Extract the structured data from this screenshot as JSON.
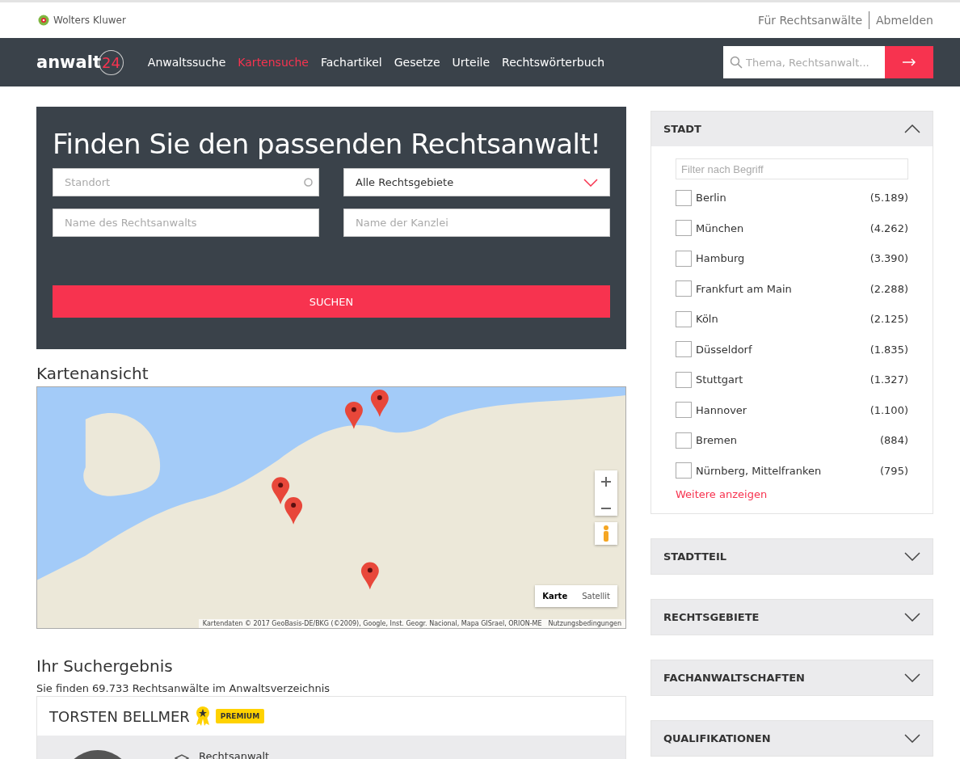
{
  "header": {
    "brand": "Wolters Kluwer",
    "links": [
      {
        "label": "Für Rechtsanwälte"
      },
      {
        "label": "Abmelden"
      }
    ]
  },
  "nav": {
    "logo": {
      "word": "anwalt",
      "number": "24"
    },
    "items": [
      {
        "label": "Anwaltssuche",
        "selected": false
      },
      {
        "label": "Kartensuche",
        "selected": true
      },
      {
        "label": "Fachartikel",
        "selected": false
      },
      {
        "label": "Gesetze",
        "selected": false
      },
      {
        "label": "Urteile",
        "selected": false
      },
      {
        "label": "Rechtswörterbuch",
        "selected": false
      }
    ],
    "search": {
      "placeholder": "Thema, Rechtsanwalt..."
    }
  },
  "search_panel": {
    "title": "Finden Sie den passenden Rechtsanwalt!",
    "fields": [
      {
        "kind": "location",
        "placeholder": "Standort"
      },
      {
        "kind": "select",
        "value": "Alle Rechtsgebiete"
      },
      {
        "kind": "text",
        "placeholder": "Name des Rechtsanwalts"
      },
      {
        "kind": "text",
        "placeholder": "Name der Kanzlei"
      }
    ],
    "button": "SUCHEN"
  },
  "map": {
    "title": "Kartenansicht",
    "map_types": [
      {
        "label": "Karte",
        "selected": true
      },
      {
        "label": "Satellit",
        "selected": false
      }
    ],
    "attribution": "Kartendaten © 2017 GeoBasis-DE/BKG (©2009), Google, Inst. Geogr. Nacional, Mapa GISrael, ORION-ME",
    "terms": "Nutzungsbedingungen"
  },
  "results": {
    "title": "Ihr Suchergebnis",
    "summary": "Sie finden 69.733 Rechtsanwälte im Anwaltsverzeichnis",
    "card": {
      "name": "TORSTEN BELLMER",
      "badge": "PREMIUM",
      "role": "Rechtsanwalt"
    }
  },
  "filters": [
    {
      "title": "STADT",
      "expanded": true,
      "filter_placeholder": "Filter nach Begriff",
      "options": [
        {
          "label": "Berlin",
          "count": "(5.189)",
          "checked": false
        },
        {
          "label": "München",
          "count": "(4.262)",
          "checked": false
        },
        {
          "label": "Hamburg",
          "count": "(3.390)",
          "checked": false
        },
        {
          "label": "Frankfurt am Main",
          "count": "(2.288)",
          "checked": false
        },
        {
          "label": "Köln",
          "count": "(2.125)",
          "checked": false
        },
        {
          "label": "Düsseldorf",
          "count": "(1.835)",
          "checked": false
        },
        {
          "label": "Stuttgart",
          "count": "(1.327)",
          "checked": false
        },
        {
          "label": "Hannover",
          "count": "(1.100)",
          "checked": false
        },
        {
          "label": "Bremen",
          "count": "(884)",
          "checked": false
        },
        {
          "label": "Nürnberg, Mittelfranken",
          "count": "(795)",
          "checked": false
        }
      ],
      "more": "Weitere anzeigen"
    },
    {
      "title": "STADTTEIL",
      "expanded": false
    },
    {
      "title": "RECHTSGEBIETE",
      "expanded": false
    },
    {
      "title": "FACHANWALTSCHAFTEN",
      "expanded": false
    },
    {
      "title": "QUALIFIKATIONEN",
      "expanded": false
    }
  ]
}
